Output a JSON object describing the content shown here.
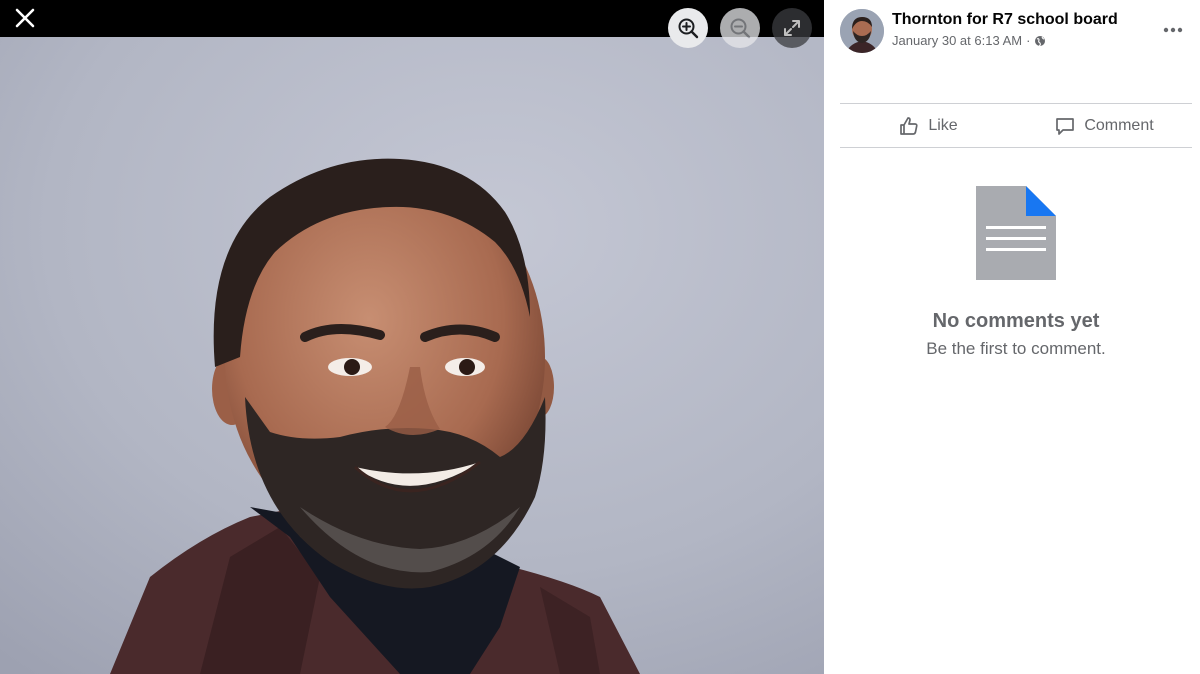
{
  "viewer": {
    "controls": {
      "close": "close-icon",
      "zoom_in": "zoom-in-icon",
      "zoom_out": "zoom-out-icon",
      "fullscreen": "fullscreen-icon"
    },
    "colors": {
      "top_bar": "#000000",
      "backdrop": "#b3b7c5",
      "jacket": "#4a2a2c",
      "shirt": "#151822"
    }
  },
  "post": {
    "author": "Thornton for R7 school board",
    "timestamp": "January 30 at 6:13 AM",
    "separator": "·",
    "privacy_icon": "globe-icon",
    "more_icon": "more-options-icon"
  },
  "actions": {
    "like_label": "Like",
    "comment_label": "Comment"
  },
  "comments": {
    "empty_title": "No comments yet",
    "empty_subtitle": "Be the first to comment."
  },
  "colors": {
    "text_primary": "#050505",
    "text_secondary": "#65676b",
    "divider": "#ced0d4",
    "accent": "#1877f2"
  }
}
